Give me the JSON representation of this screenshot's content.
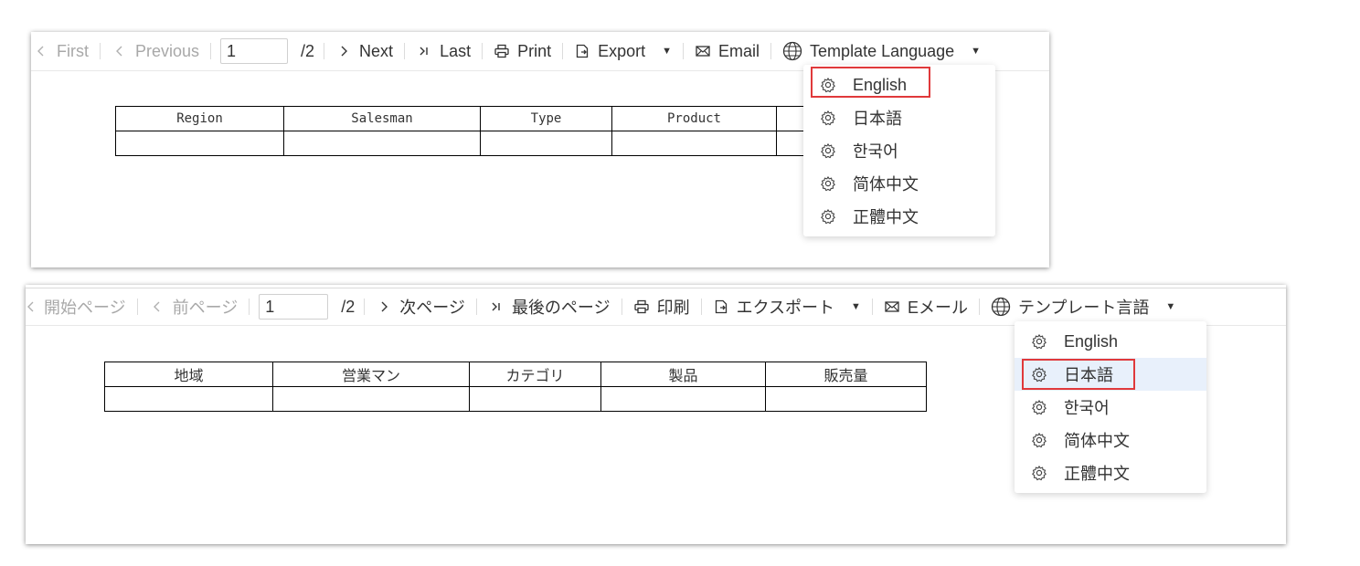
{
  "panels": [
    {
      "toolbar": {
        "first": "First",
        "previous": "Previous",
        "page_value": "1",
        "page_total": "/2",
        "next": "Next",
        "last": "Last",
        "print": "Print",
        "export": "Export",
        "email": "Email",
        "template_language": "Template Language"
      },
      "table": {
        "headers": [
          "Region",
          "Salesman",
          "Type",
          "Product",
          ""
        ]
      },
      "language_menu": {
        "items": [
          "English",
          "日本語",
          "한국어",
          "简体中文",
          "正體中文"
        ],
        "highlighted": "English"
      }
    },
    {
      "toolbar": {
        "first": "開始ページ",
        "previous": "前ページ",
        "page_value": "1",
        "page_total": "/2",
        "next": "次ページ",
        "last": "最後のページ",
        "print": "印刷",
        "export": "エクスポート",
        "email": "Eメール",
        "template_language": "テンプレート言語"
      },
      "table": {
        "headers": [
          "地域",
          "営業マン",
          "カテゴリ",
          "製品",
          "販売量"
        ]
      },
      "language_menu": {
        "items": [
          "English",
          "日本語",
          "한국어",
          "简体中文",
          "正體中文"
        ],
        "highlighted": "日本語"
      }
    }
  ],
  "colors": {
    "highlight_border": "#e0393b",
    "active_item_bg": "#e8f0fb",
    "disabled_text": "#a8a8a8"
  }
}
